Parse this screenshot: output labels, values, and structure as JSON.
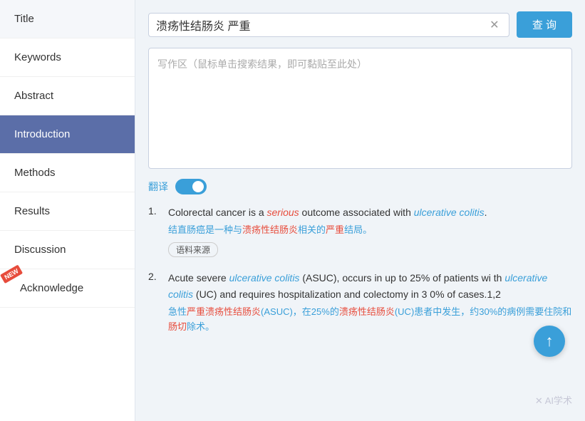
{
  "sidebar": {
    "items": [
      {
        "id": "title",
        "label": "Title",
        "active": false,
        "new": false
      },
      {
        "id": "keywords",
        "label": "Keywords",
        "active": false,
        "new": false
      },
      {
        "id": "abstract",
        "label": "Abstract",
        "active": false,
        "new": false
      },
      {
        "id": "introduction",
        "label": "Introduction",
        "active": true,
        "new": false
      },
      {
        "id": "methods",
        "label": "Methods",
        "active": false,
        "new": false
      },
      {
        "id": "results",
        "label": "Results",
        "active": false,
        "new": false
      },
      {
        "id": "discussion",
        "label": "Discussion",
        "active": false,
        "new": false
      },
      {
        "id": "acknowledge",
        "label": "Acknowledge",
        "active": false,
        "new": true
      }
    ]
  },
  "search": {
    "query": "溃疡性结肠炎 严重",
    "button_label": "查 询",
    "clear_icon": "✕",
    "placeholder": "写作区（鼠标单击搜索结果，即可黏贴至此处）"
  },
  "translate": {
    "label": "翻译",
    "enabled": true
  },
  "results": [
    {
      "number": "1.",
      "en_parts": [
        {
          "text": "Colorectal cancer is a ",
          "style": "normal"
        },
        {
          "text": "serious",
          "style": "italic-red"
        },
        {
          "text": " outcome associated with ",
          "style": "normal"
        },
        {
          "text": "ulcerative colitis",
          "style": "italic-blue"
        },
        {
          "text": ".",
          "style": "normal"
        }
      ],
      "en_full": "Colorectal cancer is a serious outcome associated with ulcerative colitis.",
      "cn_full": "结直肠癌是一种与溃疡性结肠炎相关的严重结局。",
      "cn_highlight": [
        "溃疡性结肠炎",
        "严重"
      ],
      "source_tag": "语料来源"
    },
    {
      "number": "2.",
      "en_full": "Acute severe ulcerative colitis (ASUC), occurs in up to 25% of patients with ulcerative colitis (UC) and requires hospitalization and colectomy in 30% of cases.1,2",
      "en_parts": [
        {
          "text": "Acute severe ",
          "style": "normal"
        },
        {
          "text": "ulcerative colitis",
          "style": "italic-blue"
        },
        {
          "text": " (ASUC), occurs in up to 25% of patients wi th ",
          "style": "normal"
        },
        {
          "text": "ulcerative colitis",
          "style": "italic-blue"
        },
        {
          "text": " (UC) and requires hospitalization and colectomy in 3 0% of cases.1,2",
          "style": "normal"
        }
      ],
      "cn_full": "急性严重溃疡性结肠炎(ASUC)，在25%的溃疡性结肠炎(UC)患者中发生，约30%的病例需要住院和肠切除术。",
      "cn_highlight": [
        "严重溃疡性结肠炎",
        "溃疡性结肠炎"
      ],
      "source_tag": ""
    }
  ],
  "watermark": "✕ AI学术",
  "scroll_up_icon": "↑"
}
